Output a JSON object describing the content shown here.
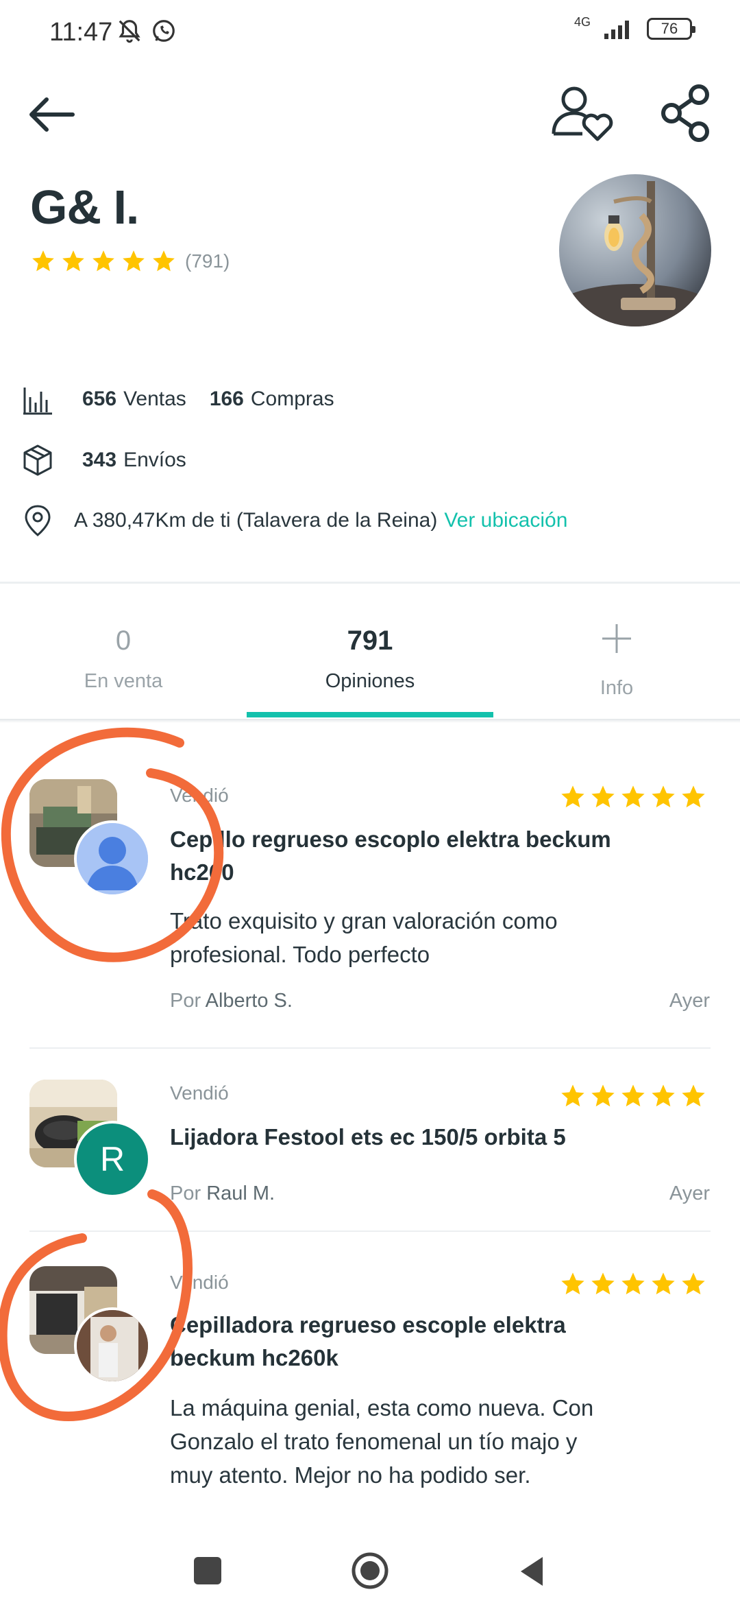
{
  "status_bar": {
    "time": "11:47",
    "network": "4G",
    "battery": "76"
  },
  "profile": {
    "name": "G& I.",
    "rating_count": "(791)",
    "stars": 5
  },
  "stats": {
    "sales_value": "656",
    "sales_label": "Ventas",
    "purchases_value": "166",
    "purchases_label": "Compras",
    "shipments_value": "343",
    "shipments_label": "Envíos",
    "location_text": "A 380,47Km de ti (Talavera de la Reina)",
    "location_link": "Ver ubicación"
  },
  "tabs": [
    {
      "value": "0",
      "label": "En venta"
    },
    {
      "value": "791",
      "label": "Opiniones"
    },
    {
      "value": "+",
      "label": "Info"
    }
  ],
  "reviews": [
    {
      "type": "Vendió",
      "title_line1": "Cepillo regrueso escoplo elektra beckum",
      "title_line2": "hc260",
      "text_line1": "Trato exquisito y gran valoración como",
      "text_line2": "profesional. Todo perfecto",
      "by_prefix": "Por",
      "author": "Alberto S.",
      "date": "Ayer",
      "stars": 5
    },
    {
      "type": "Vendió",
      "title_line1": "Lijadora Festool ets ec 150/5 orbita 5",
      "by_prefix": "Por",
      "author": "Raul M.",
      "author_initial": "R",
      "date": "Ayer",
      "stars": 5
    },
    {
      "type": "Vendió",
      "title_line1": "Cepilladora regrueso escople elektra",
      "title_line2": "beckum hc260k",
      "text_line1": "La máquina genial, esta como nueva. Con",
      "text_line2": "Gonzalo el trato fenomenal un tío majo y",
      "text_line3": "muy atento. Mejor no ha podido ser.",
      "stars": 5
    }
  ],
  "colors": {
    "accent": "#13c1ac",
    "star": "#ffc400",
    "annotation": "#f26b3a",
    "avatar_raul": "#0c8f7c",
    "avatar_default": "#4a7fe0"
  }
}
